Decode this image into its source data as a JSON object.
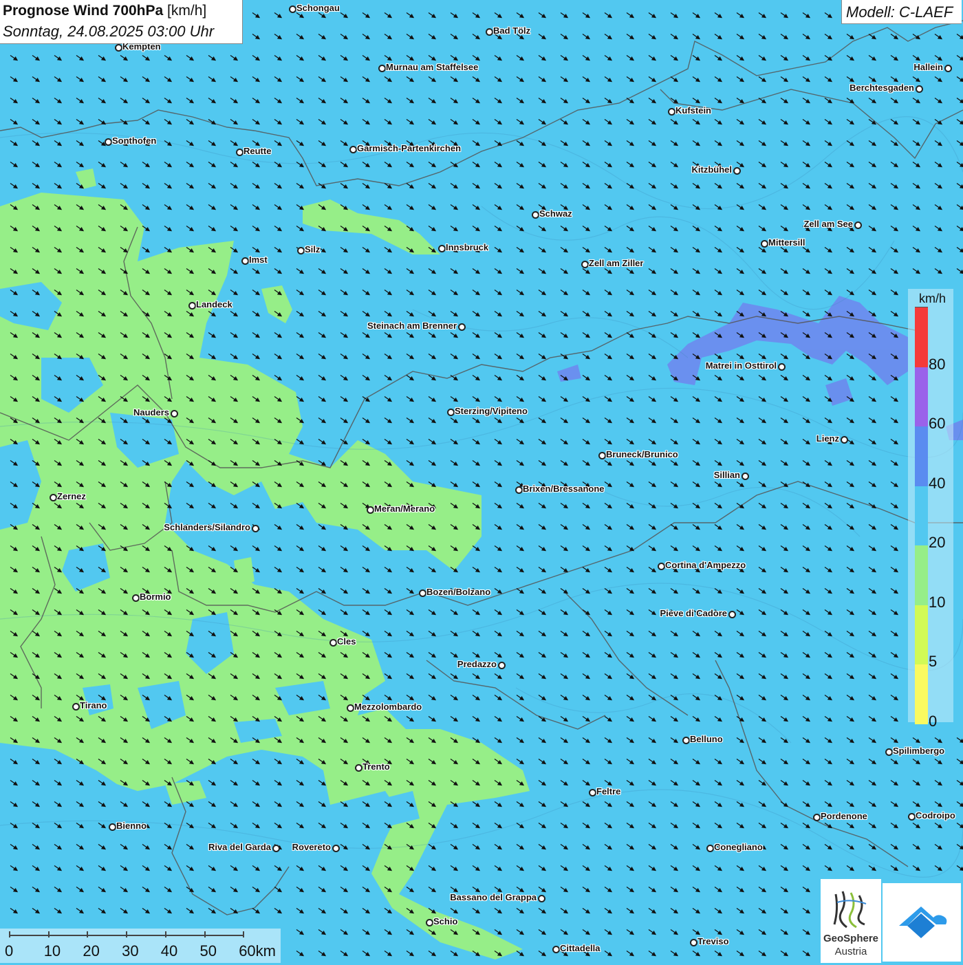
{
  "header": {
    "title_bold": "Prognose Wind 700hPa",
    "title_unit": "[km/h]",
    "date": "Sonntag, 24.08.2025 03:00 Uhr",
    "model": "Modell: C-LAEF"
  },
  "legend": {
    "unit": "km/h",
    "bands": [
      {
        "label": "0",
        "color": "#fafa60"
      },
      {
        "label": "5",
        "color": "#d2fa55"
      },
      {
        "label": "10",
        "color": "#96ee88"
      },
      {
        "label": "20",
        "color": "#52c8f0"
      },
      {
        "label": "40",
        "color": "#5a8cf0"
      },
      {
        "label": "60",
        "color": "#9a62ea"
      },
      {
        "label": "80",
        "color": "#f53a3a"
      }
    ]
  },
  "scalebar": {
    "labels": [
      "0",
      "10",
      "20",
      "30",
      "40",
      "50",
      "60km"
    ]
  },
  "logos": {
    "geosphere_line1": "GeoSphere",
    "geosphere_line2": "Austria"
  },
  "wind": {
    "direction": "from northwest (arrows pointing southeast)",
    "speed_range_kmh": [
      10,
      40
    ]
  },
  "cities": [
    {
      "name": "Schongau",
      "side": "right"
    },
    {
      "name": "Bad Tölz",
      "side": "right"
    },
    {
      "name": "Kempten",
      "side": "right"
    },
    {
      "name": "Murnau am Staffelsee",
      "side": "right"
    },
    {
      "name": "Hallein",
      "side": "left"
    },
    {
      "name": "Berchtesgaden",
      "side": "left"
    },
    {
      "name": "Kufstein",
      "side": "right"
    },
    {
      "name": "Sonthofen",
      "side": "right"
    },
    {
      "name": "Reutte",
      "side": "right"
    },
    {
      "name": "Garmisch-Partenkirchen",
      "side": "right"
    },
    {
      "name": "Kitzbühel",
      "side": "left"
    },
    {
      "name": "Schwaz",
      "side": "right"
    },
    {
      "name": "Zell am See",
      "side": "left"
    },
    {
      "name": "Innsbruck",
      "side": "right"
    },
    {
      "name": "Mittersill",
      "side": "right"
    },
    {
      "name": "Silz",
      "side": "right"
    },
    {
      "name": "Imst",
      "side": "right"
    },
    {
      "name": "Zell am Ziller",
      "side": "right"
    },
    {
      "name": "Landeck",
      "side": "right"
    },
    {
      "name": "Steinach am Brenner",
      "side": "left"
    },
    {
      "name": "Matrei in Osttirol",
      "side": "left"
    },
    {
      "name": "Nauders",
      "side": "left"
    },
    {
      "name": "Sterzing/Vipiteno",
      "side": "right"
    },
    {
      "name": "Lienz",
      "side": "left"
    },
    {
      "name": "Bruneck/Brunico",
      "side": "right"
    },
    {
      "name": "Sillian",
      "side": "left"
    },
    {
      "name": "Brixen/Bressanone",
      "side": "right"
    },
    {
      "name": "Zernez",
      "side": "right"
    },
    {
      "name": "Meran/Merano",
      "side": "right"
    },
    {
      "name": "Schlanders/Silandro",
      "side": "left"
    },
    {
      "name": "Cortina d'Ampezzo",
      "side": "right"
    },
    {
      "name": "Bozen/Bolzano",
      "side": "right"
    },
    {
      "name": "Bormio",
      "side": "right"
    },
    {
      "name": "Pieve di Cadore",
      "side": "left"
    },
    {
      "name": "Cles",
      "side": "right"
    },
    {
      "name": "Predazzo",
      "side": "left"
    },
    {
      "name": "Tirano",
      "side": "right"
    },
    {
      "name": "Mezzolombardo",
      "side": "right"
    },
    {
      "name": "Belluno",
      "side": "right"
    },
    {
      "name": "Spilimbergo",
      "side": "right"
    },
    {
      "name": "Trento",
      "side": "right"
    },
    {
      "name": "Feltre",
      "side": "right"
    },
    {
      "name": "Pordenone",
      "side": "right"
    },
    {
      "name": "Codroipo",
      "side": "right"
    },
    {
      "name": "Bienno",
      "side": "right"
    },
    {
      "name": "Riva del Garda",
      "side": "left"
    },
    {
      "name": "Rovereto",
      "side": "left"
    },
    {
      "name": "Conegliano",
      "side": "right"
    },
    {
      "name": "Bassano del Grappa",
      "side": "left"
    },
    {
      "name": "Schio",
      "side": "right"
    },
    {
      "name": "Treviso",
      "side": "right"
    },
    {
      "name": "Cittadella",
      "side": "right"
    }
  ]
}
